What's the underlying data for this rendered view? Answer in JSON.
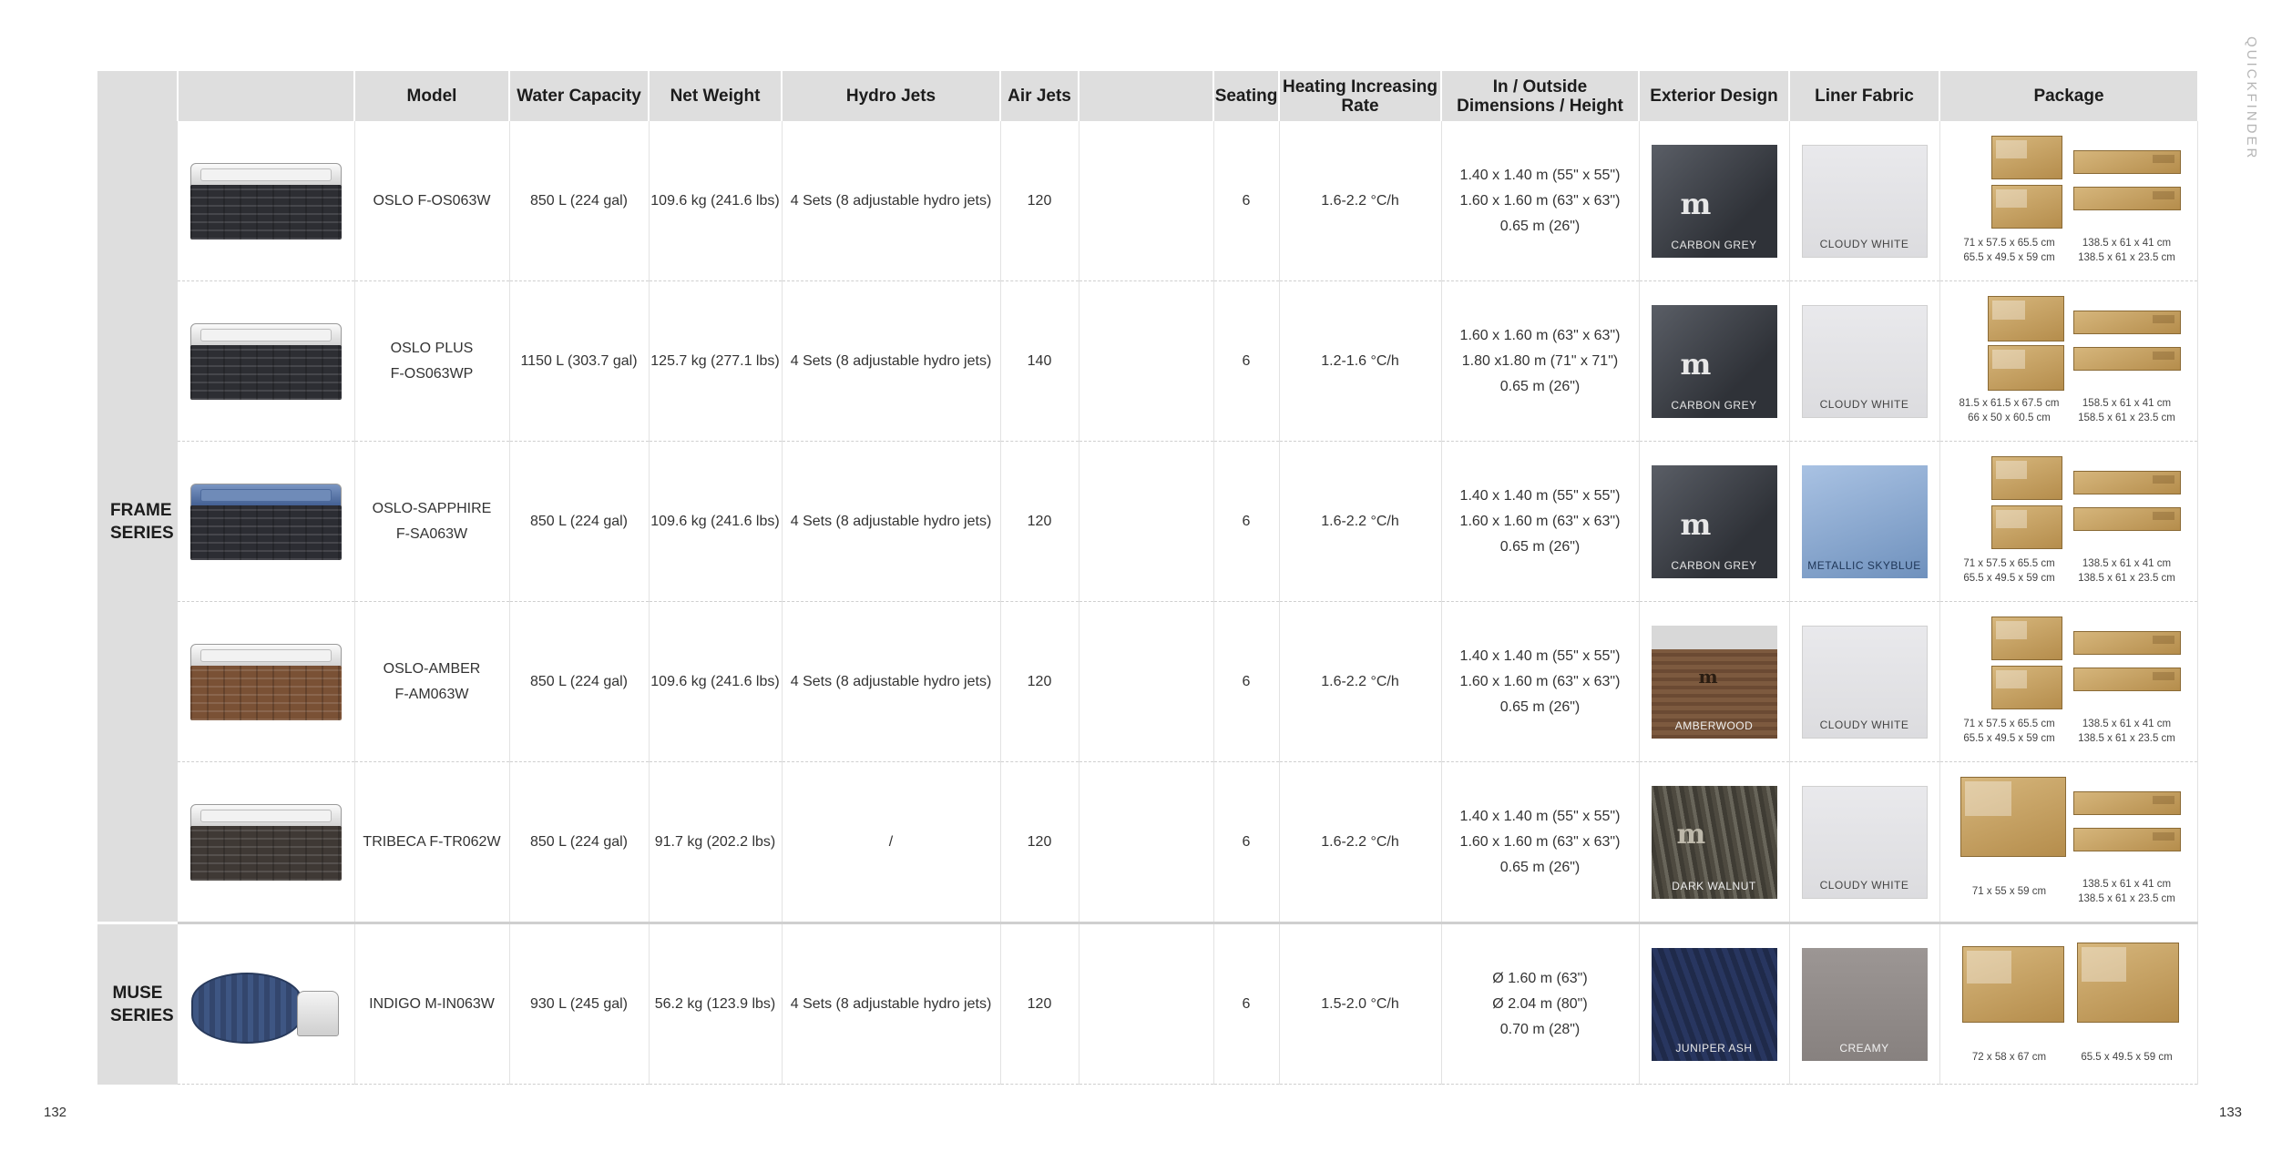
{
  "side_label": "QUICKFINDER",
  "page_left": "132",
  "page_right": "133",
  "headers": [
    "",
    "",
    "Model",
    "Water Capacity",
    "Net Weight",
    "Hydro Jets",
    "Air Jets",
    "",
    "Seating",
    "Heating Increasing Rate",
    "In / Outside Dimensions / Height",
    "Exterior Design",
    "Liner Fabric",
    "Package"
  ],
  "series": [
    {
      "name": "FRAME SERIES"
    },
    {
      "name": "MUSE SERIES"
    }
  ],
  "rows": [
    {
      "model_l1": "OSLO F-OS063W",
      "model_l2": "",
      "water": "850 L (224 gal)",
      "weight": "109.6 kg (241.6 lbs)",
      "hydro": "4 Sets (8 adjustable hydro jets)",
      "air": "120",
      "seating": "6",
      "heating": "1.6-2.2 °C/h",
      "dim1": "1.40 x 1.40 m (55\" x 55\")",
      "dim2": "1.60 x 1.60 m (63\" x 63\")",
      "dim3": "0.65 m (26\")",
      "exterior": "CARBON GREY",
      "liner": "CLOUDY WHITE",
      "pkg1": "71 x 57.5 x 65.5 cm",
      "pkg2": "138.5 x 61 x 41 cm",
      "pkg3": "65.5 x 49.5 x 59 cm",
      "pkg4": "138.5 x 61 x 23.5 cm"
    },
    {
      "model_l1": "OSLO PLUS",
      "model_l2": "F-OS063WP",
      "water": "1150 L (303.7 gal)",
      "weight": "125.7 kg (277.1 lbs)",
      "hydro": "4 Sets (8 adjustable hydro jets)",
      "air": "140",
      "seating": "6",
      "heating": "1.2-1.6 °C/h",
      "dim1": "1.60 x 1.60 m (63\" x 63\")",
      "dim2": "1.80 x1.80 m (71\" x 71\")",
      "dim3": "0.65 m (26\")",
      "exterior": "CARBON GREY",
      "liner": "CLOUDY WHITE",
      "pkg1": "81.5 x 61.5 x 67.5 cm",
      "pkg2": "158.5 x 61 x 41 cm",
      "pkg3": "66 x 50 x 60.5 cm",
      "pkg4": "158.5 x 61 x 23.5 cm"
    },
    {
      "model_l1": "OSLO-SAPPHIRE",
      "model_l2": "F-SA063W",
      "water": "850 L (224 gal)",
      "weight": "109.6 kg (241.6 lbs)",
      "hydro": "4 Sets (8 adjustable hydro jets)",
      "air": "120",
      "seating": "6",
      "heating": "1.6-2.2 °C/h",
      "dim1": "1.40 x 1.40 m (55\" x 55\")",
      "dim2": "1.60 x 1.60 m (63\" x 63\")",
      "dim3": "0.65 m (26\")",
      "exterior": "CARBON GREY",
      "liner": "METALLIC SKYBLUE",
      "pkg1": "71 x 57.5 x 65.5 cm",
      "pkg2": "138.5 x 61 x 41 cm",
      "pkg3": "65.5 x 49.5 x 59 cm",
      "pkg4": "138.5 x 61 x 23.5 cm"
    },
    {
      "model_l1": "OSLO-AMBER",
      "model_l2": "F-AM063W",
      "water": "850 L (224 gal)",
      "weight": "109.6 kg (241.6 lbs)",
      "hydro": "4 Sets (8 adjustable hydro jets)",
      "air": "120",
      "seating": "6",
      "heating": "1.6-2.2 °C/h",
      "dim1": "1.40 x 1.40 m (55\" x 55\")",
      "dim2": "1.60 x 1.60 m (63\" x 63\")",
      "dim3": "0.65 m (26\")",
      "exterior": "AMBERWOOD",
      "liner": "CLOUDY WHITE",
      "pkg1": "71 x 57.5 x 65.5 cm",
      "pkg2": "138.5 x 61 x 41 cm",
      "pkg3": "65.5 x 49.5 x 59 cm",
      "pkg4": "138.5 x 61 x 23.5 cm"
    },
    {
      "model_l1": "TRIBECA F-TR062W",
      "model_l2": "",
      "water": "850 L (224 gal)",
      "weight": "91.7 kg (202.2 lbs)",
      "hydro": "/",
      "air": "120",
      "seating": "6",
      "heating": "1.6-2.2 °C/h",
      "dim1": "1.40 x 1.40 m (55\" x 55\")",
      "dim2": "1.60 x 1.60 m (63\" x 63\")",
      "dim3": "0.65 m (26\")",
      "exterior": "DARK WALNUT",
      "liner": "CLOUDY WHITE",
      "pkg1": "71 x 55 x 59 cm",
      "pkg2": "138.5 x 61 x 41 cm",
      "pkg3": "",
      "pkg4": "138.5 x 61 x 23.5 cm"
    },
    {
      "model_l1": "INDIGO M-IN063W",
      "model_l2": "",
      "water": "930 L (245 gal)",
      "weight": "56.2 kg (123.9 lbs)",
      "hydro": "4 Sets (8 adjustable hydro jets)",
      "air": "120",
      "seating": "6",
      "heating": "1.5-2.0 °C/h",
      "dim1": "Ø 1.60 m (63\")",
      "dim2": "Ø 2.04 m (80\")",
      "dim3": "0.70 m (28\")",
      "exterior": "JUNIPER ASH",
      "liner": "CREAMY",
      "pkg1": "72 x 58 x 67 cm",
      "pkg2": "65.5 x 49.5 x 59 cm",
      "pkg3": "",
      "pkg4": ""
    }
  ]
}
